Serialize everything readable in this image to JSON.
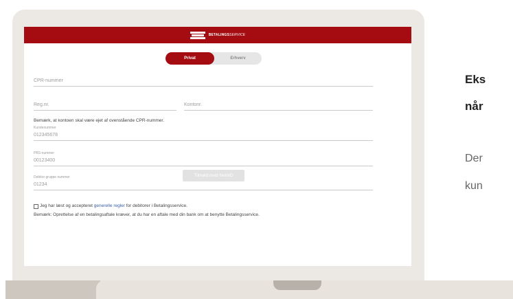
{
  "brand": {
    "name_bold": "BETALINGS",
    "name_light": "SERVICE"
  },
  "toggle": {
    "active": "Privat",
    "inactive": "Erhverv"
  },
  "form": {
    "cpr_placeholder": "CPR-nummer",
    "reg_placeholder": "Reg.nr.",
    "konto_placeholder": "Kontonr.",
    "ownership_note": "Bemærk, at kontoen skal være ejet af ovenstående CPR-nummer.",
    "kundenummer_label": "Kundenummer",
    "kundenummer_value": "012345678",
    "pbs_label": "PBS-nummer",
    "pbs_value": "00123400",
    "debitor_label": "Debitor gruppe nummer",
    "debitor_value": "01234",
    "terms_prefix": "Jeg har læst og accepteret ",
    "terms_link": "generelle regler",
    "terms_suffix": " for debitorer i Betalingsservice.",
    "agreement_note": "Bemærk: Oprettelse af en betalingsaftale kræver, at du har en aftale med din bank om at benytte Betalingsservice.",
    "submit_label": "Tilmeld med NemID"
  },
  "side": {
    "heading_line1": "Eks",
    "heading_line2": "når",
    "body_line1": "Der",
    "body_line2": "kun"
  },
  "colors": {
    "brand_red": "#a50c11",
    "link_blue": "#3b5fa8"
  }
}
